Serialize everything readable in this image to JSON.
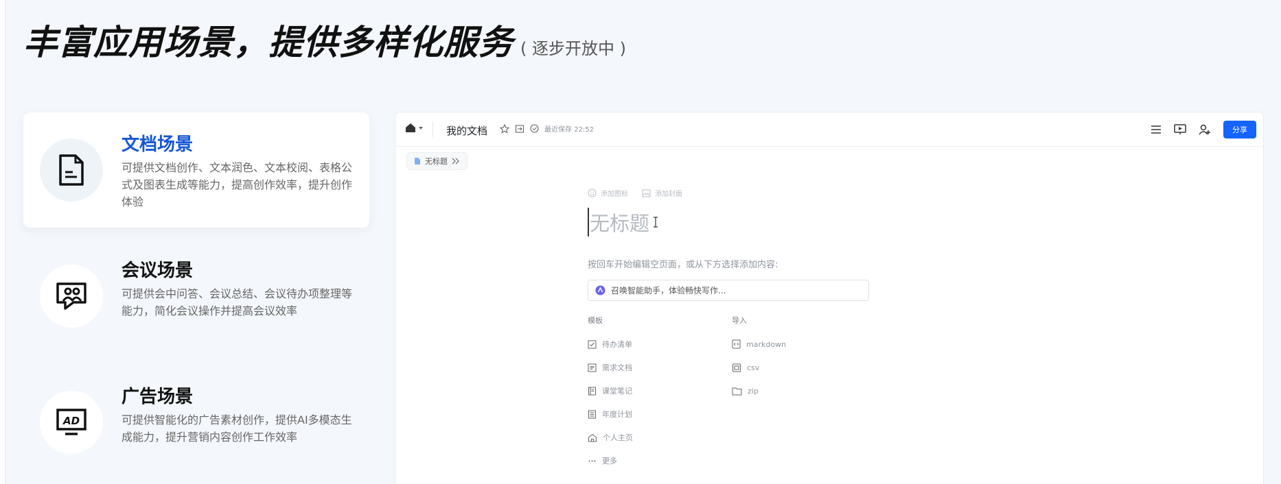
{
  "headline": {
    "main": "丰富应用场景，提供多样化服务",
    "sub": "( 逐步开放中 )"
  },
  "scenes": [
    {
      "title": "文档场景",
      "desc": "可提供文档创作、文本润色、文本校阅、表格公式及图表生成等能力，提高创作效率，提升创作体验",
      "icon": "document-icon",
      "active": true
    },
    {
      "title": "会议场景",
      "desc": "可提供会中问答、会议总结、会议待办项整理等能力，简化会议操作并提高会议效率",
      "icon": "meeting-icon",
      "active": false
    },
    {
      "title": "广告场景",
      "desc": "可提供智能化的广告素材创作，提供AI多模态生成能力，提升营销内容创作工作效率",
      "icon": "ad-monitor-icon",
      "active": false
    }
  ],
  "editor": {
    "doc_name": "我的文档",
    "save_status": "最近保存 22:52",
    "share_label": "分享",
    "breadcrumb": "无标题",
    "add_icon_label": "添加图标",
    "add_cover_label": "添加封面",
    "title_placeholder": "无标题",
    "hint": "按回车开始编辑空页面，或从下方选择添加内容:",
    "ai_prompt": "召唤智能助手，体验畅快写作...",
    "templates_title": "模板",
    "templates": [
      "待办清单",
      "需求文档",
      "课堂笔记",
      "年度计划",
      "个人主页",
      "更多"
    ],
    "import_title": "导入",
    "imports": [
      "markdown",
      "csv",
      "zip"
    ]
  },
  "colors": {
    "accent": "#1664ff",
    "active_title": "#1456d6"
  }
}
